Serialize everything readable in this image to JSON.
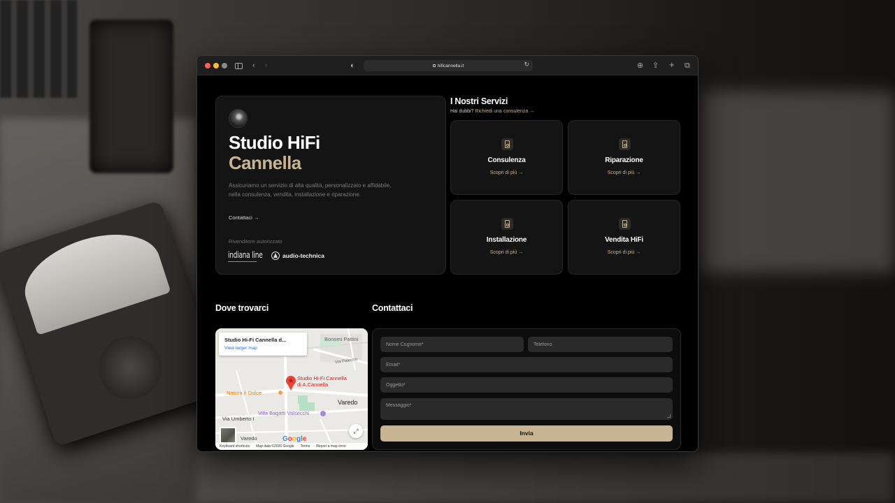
{
  "browser": {
    "url": "hificannella.it"
  },
  "hero": {
    "title_line1": "Studio HiFi",
    "title_line2": "Cannella",
    "description": "Assicuriamo un servizio di alta qualità, personalizzato e affidabile, nella consulenza, vendita, installazione e riparazione.",
    "contact_link": "Contattaci →",
    "reseller_label": "Rivenditore autorizzato",
    "brands": [
      "indiana line",
      "audio-technica"
    ]
  },
  "services": {
    "title": "I Nostri Servizi",
    "subtitle_prefix": "Hai dubbi?",
    "subtitle_link": "Richiedi una consulenza →",
    "items": [
      {
        "name": "Consulenza",
        "link": "Scopri di più →"
      },
      {
        "name": "Riparazione",
        "link": "Scopri di più →"
      },
      {
        "name": "Installazione",
        "link": "Scopri di più →"
      },
      {
        "name": "Vendita HiFi",
        "link": "Scopri di più →"
      }
    ]
  },
  "location": {
    "title": "Dove trovarci",
    "map": {
      "card_title": "Studio Hi-Fi Cannella d...",
      "card_link": "View larger map",
      "pin_label_1": "Studio Hi-Fi Cannella",
      "pin_label_2": "di A.Cannella",
      "labels": {
        "bonomi": "Bonomi Pattini",
        "via_palermo": "Via Palermo",
        "natura": "Natura è Dolce",
        "varedo": "Varedo",
        "villa": "Villa Bagatti Valsecchi",
        "via_umberto": "Via Umberto I",
        "varedo_station": "Varedo"
      },
      "footer": [
        "Keyboard shortcuts",
        "Map data ©2026 Google",
        "Terms",
        "Report a map error"
      ],
      "google": [
        "G",
        "o",
        "o",
        "g",
        "l",
        "e"
      ]
    }
  },
  "contact": {
    "title": "Contattaci",
    "fields": {
      "name_placeholder": "Nome Cognome*",
      "phone_placeholder": "Telefono",
      "email_placeholder": "Email*",
      "subject_placeholder": "Oggetto*",
      "message_placeholder": "Messaggio*"
    },
    "submit_label": "Invia"
  },
  "colors": {
    "accent": "#c8b491",
    "page_bg": "#000000",
    "card_bg": "#141414"
  }
}
